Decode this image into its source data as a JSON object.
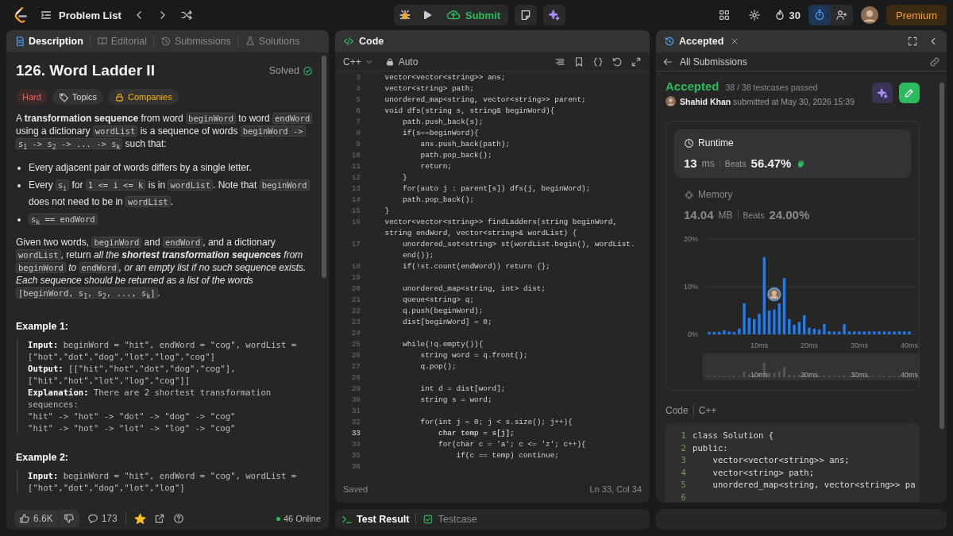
{
  "topbar": {
    "problem_list": "Problem List",
    "submit": "Submit",
    "streak": "30",
    "premium": "Premium"
  },
  "description_panel": {
    "tabs": [
      {
        "label": "Description",
        "selected": true
      },
      {
        "label": "Editorial",
        "selected": false
      },
      {
        "label": "Submissions",
        "selected": false
      },
      {
        "label": "Solutions",
        "selected": false
      }
    ],
    "title": "126. Word Ladder II",
    "status": "Solved",
    "tags": [
      {
        "kind": "difficulty",
        "label": "Hard"
      },
      {
        "kind": "topics",
        "label": "Topics"
      },
      {
        "kind": "companies",
        "label": "Companies"
      }
    ],
    "blocks": [
      {
        "kind": "paragraph",
        "segments": [
          {
            "kind": "text",
            "text": "A **transformation sequence** from word "
          },
          {
            "kind": "code",
            "text": "beginWord"
          },
          {
            "kind": "text",
            "text": " to word "
          },
          {
            "kind": "code",
            "text": "endWord"
          },
          {
            "kind": "text",
            "text": " using a dictionary "
          },
          {
            "kind": "code",
            "text": "wordList"
          },
          {
            "kind": "text",
            "text": " is a sequence of words "
          },
          {
            "kind": "code",
            "text": "beginWord -> s$_{1}$ -> s$_{2}$ -> ... -> s$_{k}$"
          },
          {
            "kind": "text",
            "text": " such that:"
          }
        ]
      },
      {
        "kind": "bullets",
        "items": [
          [
            {
              "kind": "text",
              "text": "Every adjacent pair of words differs by a single letter."
            }
          ],
          [
            {
              "kind": "text",
              "text": "Every "
            },
            {
              "kind": "code",
              "text": "s$_{i}$"
            },
            {
              "kind": "text",
              "text": " for "
            },
            {
              "kind": "code",
              "text": "1 <= i <= k"
            },
            {
              "kind": "text",
              "text": " is in "
            },
            {
              "kind": "code",
              "text": "wordList"
            },
            {
              "kind": "text",
              "text": ". Note that "
            },
            {
              "kind": "code",
              "text": "beginWord"
            },
            {
              "kind": "text",
              "text": " does not need to be in "
            },
            {
              "kind": "code",
              "text": "wordList"
            },
            {
              "kind": "text",
              "text": "."
            }
          ],
          [
            {
              "kind": "code",
              "text": "s$_{k}$ == endWord"
            }
          ]
        ]
      },
      {
        "kind": "paragraph",
        "segments": [
          {
            "kind": "text",
            "text": "Given two words, "
          },
          {
            "kind": "code",
            "text": "beginWord"
          },
          {
            "kind": "text",
            "text": " and "
          },
          {
            "kind": "code",
            "text": "endWord"
          },
          {
            "kind": "text",
            "text": ", and a dictionary "
          },
          {
            "kind": "code",
            "text": "wordList"
          },
          {
            "kind": "text",
            "text": ", return "
          },
          {
            "kind": "em",
            "text": "all the **shortest transformation sequences** from "
          },
          {
            "kind": "code",
            "text": "beginWord"
          },
          {
            "kind": "em",
            "text": " to "
          },
          {
            "kind": "code",
            "text": "endWord"
          },
          {
            "kind": "em",
            "text": ", or an empty list if no such sequence exists. Each sequence should be returned as a list of the words "
          },
          {
            "kind": "code",
            "text": "[beginWord, s$_{1}$, s$_{2}$, ..., s$_{k}$]"
          },
          {
            "kind": "text",
            "text": "."
          }
        ]
      },
      {
        "kind": "heading",
        "text": "Example 1:"
      },
      {
        "kind": "example",
        "lines": [
          "**Input:** beginWord = \"hit\", endWord = \"cog\", wordList =",
          "[\"hot\",\"dot\",\"dog\",\"lot\",\"log\",\"cog\"]",
          "**Output:** [[\"hit\",\"hot\",\"dot\",\"dog\",\"cog\"],",
          "[\"hit\",\"hot\",\"lot\",\"log\",\"cog\"]]",
          "**Explanation:** There are 2 shortest transformation",
          "sequences:",
          "\"hit\" -> \"hot\" -> \"dot\" -> \"dog\" -> \"cog\"",
          "\"hit\" -> \"hot\" -> \"lot\" -> \"log\" -> \"cog\""
        ]
      },
      {
        "kind": "heading",
        "text": "Example 2:"
      },
      {
        "kind": "example",
        "lines": [
          "**Input:** beginWord = \"hit\", endWord = \"cog\", wordList =",
          "[\"hot\",\"dot\",\"dog\",\"lot\",\"log\"]"
        ]
      }
    ],
    "footer": {
      "likes": "6.6K",
      "comments": "173",
      "online": "46 Online"
    }
  },
  "editor": {
    "tab": "Code",
    "language": "C++",
    "mode": "Auto",
    "lines": [
      {
        "number": "3",
        "text": "    vector<vector<string>> ans;",
        "current": false
      },
      {
        "number": "4",
        "text": "    vector<string> path;",
        "current": false
      },
      {
        "number": "5",
        "text": "    unordered_map<string, vector<string>> parent;",
        "current": false
      },
      {
        "number": "6",
        "text": "    void dfs(string s, string& beginWord){",
        "current": false
      },
      {
        "number": "7",
        "text": "        path.push_back(s);",
        "current": false
      },
      {
        "number": "8",
        "text": "        if(s==beginWord){",
        "current": false
      },
      {
        "number": "9",
        "text": "            ans.push_back(path);",
        "current": false
      },
      {
        "number": "10",
        "text": "            path.pop_back();",
        "current": false
      },
      {
        "number": "11",
        "text": "            return;",
        "current": false
      },
      {
        "number": "12",
        "text": "        }",
        "current": false
      },
      {
        "number": "13",
        "text": "        for(auto j : parent[s]) dfs(j, beginWord);",
        "current": false
      },
      {
        "number": "14",
        "text": "        path.pop_back();",
        "current": false
      },
      {
        "number": "15",
        "text": "    }",
        "current": false
      },
      {
        "number": "16",
        "text": "    vector<vector<string>> findLadders(string beginWord,",
        "current": false
      },
      {
        "text": "    string endWord, vector<string>& wordList) {",
        "current": false
      },
      {
        "number": "17",
        "text": "        unordered_set<string> st(wordList.begin(), wordList.",
        "current": false
      },
      {
        "text": "        end());",
        "current": false
      },
      {
        "number": "18",
        "text": "        if(!st.count(endWord)) return {};",
        "current": false
      },
      {
        "number": "19",
        "current": false
      },
      {
        "number": "20",
        "text": "        unordered_map<string, int> dist;",
        "current": false
      },
      {
        "number": "21",
        "text": "        queue<string> q;",
        "current": false
      },
      {
        "number": "22",
        "text": "        q.push(beginWord);",
        "current": false
      },
      {
        "number": "23",
        "text": "        dist[beginWord] = 0;",
        "current": false
      },
      {
        "number": "24",
        "current": false
      },
      {
        "number": "25",
        "text": "        while(!q.empty()){",
        "current": false
      },
      {
        "number": "26",
        "text": "            string word = q.front();",
        "current": false
      },
      {
        "number": "27",
        "text": "            q.pop();",
        "current": false
      },
      {
        "number": "28",
        "current": false
      },
      {
        "number": "29",
        "text": "            int d = dist[word];",
        "current": false
      },
      {
        "number": "30",
        "text": "            string s = word;",
        "current": false
      },
      {
        "number": "31",
        "current": false
      },
      {
        "number": "32",
        "text": "            for(int j = 0; j < s.size(); j++){",
        "current": false
      },
      {
        "number": "33",
        "text": "                char temp = s[j];",
        "current": true
      },
      {
        "number": "34",
        "text": "                for(char c = 'a'; c <= 'z'; c++){",
        "current": false
      },
      {
        "number": "35",
        "text": "                    if(c == temp) continue;",
        "current": false
      },
      {
        "number": "36",
        "current": false
      }
    ],
    "status": "Saved",
    "cursor": "Ln 33, Col 34"
  },
  "bottom_tabs": [
    {
      "label": "Test Result",
      "selected": true
    },
    {
      "label": "Testcase",
      "selected": false
    }
  ],
  "result_panel": {
    "tab": "Accepted",
    "back_link": "All Submissions",
    "verdict": "Accepted",
    "testcases": "38 / 38 testcases passed",
    "submitter": "**Shahid Khan** submitted at May 30, 2026 15:39",
    "metrics": [
      {
        "label": "Runtime",
        "value": "13",
        "unit": "ms",
        "beats_label": "Beats",
        "beats": "56.47%",
        "selected": true
      },
      {
        "label": "Memory",
        "value": "14.04",
        "unit": "MB",
        "beats_label": "Beats",
        "beats": "24.00%",
        "selected": false
      }
    ],
    "chart_data": {
      "type": "bar",
      "x": [
        0,
        1,
        2,
        3,
        4,
        5,
        6,
        7,
        8,
        9,
        10,
        11,
        12,
        13,
        14,
        15,
        16,
        17,
        18,
        19,
        20,
        21,
        22,
        23,
        24,
        25,
        26,
        27,
        28,
        29,
        30,
        31,
        32,
        33,
        34,
        35,
        36,
        37,
        38,
        39,
        40
      ],
      "values": [
        0.5,
        0.5,
        0.5,
        0.8,
        0.6,
        0.5,
        1.2,
        6.5,
        3.5,
        3.2,
        4.3,
        16.2,
        5,
        5.2,
        6.5,
        11.8,
        3.2,
        2,
        2.6,
        4,
        1.4,
        1.2,
        1,
        2.2,
        0.6,
        0.6,
        0.6,
        2.1,
        0.6,
        0.6,
        0.6,
        0.6,
        0.6,
        0.6,
        0.6,
        0.6,
        0.6,
        0.6,
        0.6,
        0.6,
        0.6
      ],
      "xlim": [
        0,
        40
      ],
      "ylim": [
        0,
        20
      ],
      "xticks": [
        {
          "value": 10,
          "label": "10ms"
        },
        {
          "value": 20,
          "label": "20ms"
        },
        {
          "value": 30,
          "label": "30ms"
        },
        {
          "value": 40,
          "label": "40ms"
        }
      ],
      "yticks": [
        {
          "value": 0,
          "label": "0%"
        },
        {
          "value": 10,
          "label": "10%"
        },
        {
          "value": 20,
          "label": "20%"
        }
      ]
    },
    "navigator_labels": [
      "10ms",
      "20ms",
      "30ms",
      "40ms"
    ],
    "code_label": "Code",
    "code_language": "C++",
    "code_lines": [
      {
        "number": "1",
        "text": "class Solution {"
      },
      {
        "number": "2",
        "text": "public:"
      },
      {
        "number": "3",
        "text": "    vector<vector<string>> ans;"
      },
      {
        "number": "4",
        "text": "    vector<string> path;"
      },
      {
        "number": "5",
        "text": "    unordered_map<string, vector<string>> pa"
      },
      {
        "number": "6"
      }
    ]
  }
}
